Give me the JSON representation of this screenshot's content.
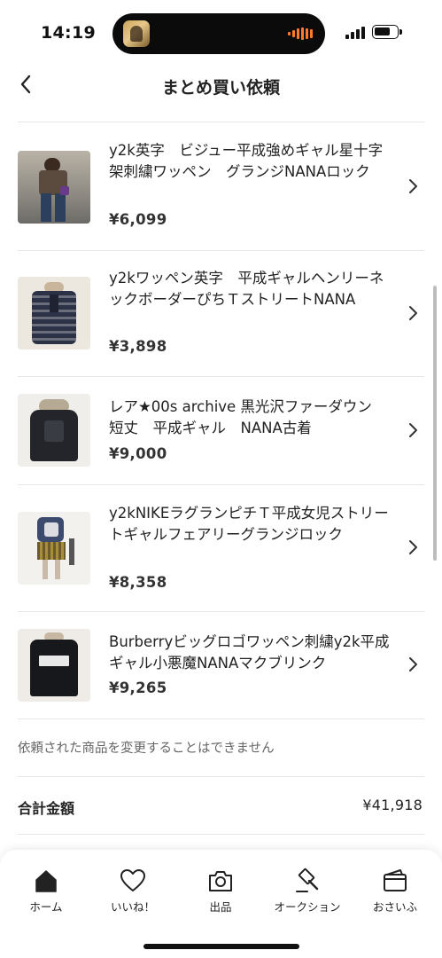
{
  "status_bar": {
    "time": "14:19"
  },
  "header": {
    "title": "まとめ買い依頼"
  },
  "items": [
    {
      "title": "y2k英字　ビジュー平成強めギャル星十字架刺繍ワッペン　グランジNANAロック",
      "price": "¥6,099"
    },
    {
      "title": "y2kワッペン英字　平成ギャルヘンリーネックボーダーぴちＴストリートNANA",
      "price": "¥3,898"
    },
    {
      "title": "レア★00s archive 黒光沢ファーダウン　短丈　平成ギャル　NANA古着",
      "price": "¥9,000"
    },
    {
      "title": "y2kNIKEラグランピチＴ平成女児ストリートギャルフェアリーグランジロック",
      "price": "¥8,358"
    },
    {
      "title": "Burberryビッグロゴワッペン刺繍y2k平成ギャル小悪魔NANAマクブリンク",
      "price": "¥9,265"
    }
  ],
  "notice": "依頼された商品を変更することはできません",
  "total": {
    "label": "合計金額",
    "value": "¥41,918"
  },
  "tabs": [
    {
      "label": "ホーム",
      "icon": "home-icon"
    },
    {
      "label": "いいね！",
      "icon": "heart-icon"
    },
    {
      "label": "出品",
      "icon": "camera-icon"
    },
    {
      "label": "オークション",
      "icon": "gavel-icon"
    },
    {
      "label": "おさいふ",
      "icon": "wallet-icon"
    }
  ]
}
